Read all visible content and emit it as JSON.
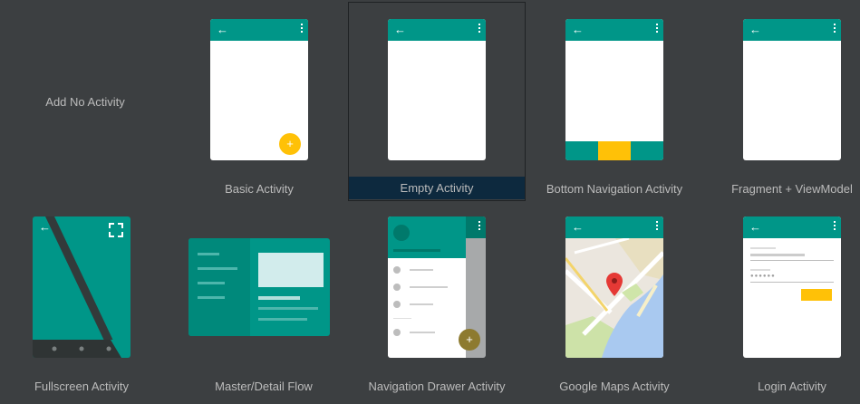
{
  "templates": [
    {
      "id": "no-activity",
      "label": "Add No Activity"
    },
    {
      "id": "basic",
      "label": "Basic Activity",
      "fab_symbol": "+"
    },
    {
      "id": "empty",
      "label": "Empty Activity",
      "selected": true
    },
    {
      "id": "bottom-nav",
      "label": "Bottom Navigation Activity"
    },
    {
      "id": "fragment-viewmodel",
      "label": "Fragment + ViewModel"
    },
    {
      "id": "fullscreen",
      "label": "Fullscreen Activity"
    },
    {
      "id": "master-detail",
      "label": "Master/Detail Flow"
    },
    {
      "id": "nav-drawer",
      "label": "Navigation Drawer Activity",
      "fab_symbol": "+"
    },
    {
      "id": "google-maps",
      "label": "Google Maps Activity"
    },
    {
      "id": "login",
      "label": "Login Activity",
      "password_dots": "●●●●●●"
    }
  ],
  "icons": {
    "back_arrow": "←"
  },
  "colors": {
    "background": "#3c3f41",
    "teal": "#009688",
    "accent_yellow": "#ffc107",
    "selection": "#0d293e",
    "label_text": "#bbbbbb"
  }
}
